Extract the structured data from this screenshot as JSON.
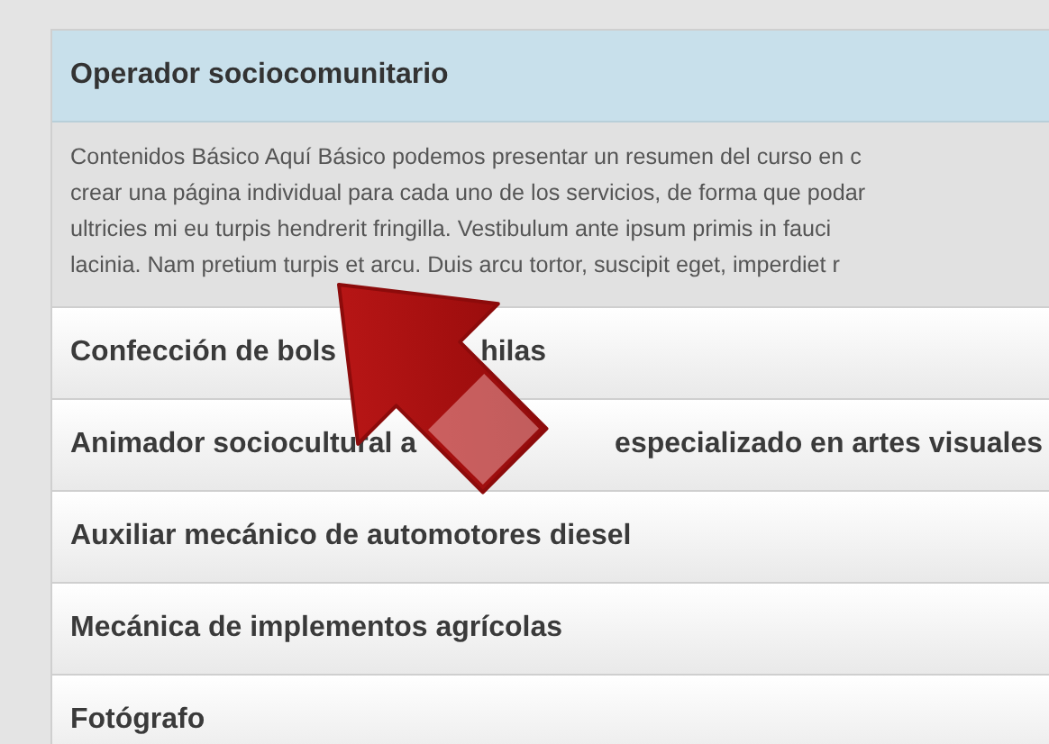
{
  "accordion": {
    "open_section": {
      "title": "Operador sociocomunitario",
      "expanded": true,
      "description_lines": [
        "Contenidos Básico Aquí Básico podemos presentar un resumen del curso en c",
        "crear una página individual para cada uno de los servicios, de forma que podar",
        "ultricies mi eu turpis hendrerit fringilla. Vestibulum ante ipsum primis in fauci",
        "lacinia. Nam pretium turpis et arcu. Duis arcu tortor, suscipit eget, imperdiet r"
      ]
    },
    "sections": [
      {
        "title_parts": [
          "Confección de bols",
          "hilas"
        ],
        "expanded": false
      },
      {
        "title_parts": [
          "Animador sociocultural a",
          "especializado en artes visuales"
        ],
        "expanded": false
      },
      {
        "title_parts": [
          "Auxiliar mecánico de automotores diesel"
        ],
        "expanded": false
      },
      {
        "title_parts": [
          "Mecánica de implementos agrícolas"
        ],
        "expanded": false
      },
      {
        "title_parts": [
          "Fotógrafo"
        ],
        "expanded": false
      }
    ]
  }
}
